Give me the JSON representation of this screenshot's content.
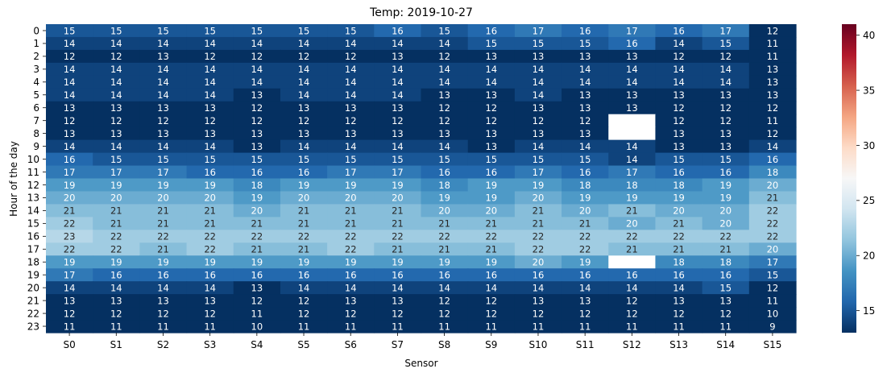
{
  "chart_data": {
    "type": "heatmap",
    "title": "Temp: 2019-10-27",
    "xlabel": "Sensor",
    "ylabel": "Hour of the day",
    "x_categories": [
      "S0",
      "S1",
      "S2",
      "S3",
      "S4",
      "S5",
      "S6",
      "S7",
      "S8",
      "S9",
      "S10",
      "S11",
      "S12",
      "S13",
      "S14",
      "S15"
    ],
    "y_categories": [
      "0",
      "1",
      "2",
      "3",
      "4",
      "5",
      "6",
      "7",
      "8",
      "9",
      "10",
      "11",
      "12",
      "13",
      "14",
      "15",
      "16",
      "17",
      "18",
      "19",
      "20",
      "21",
      "22",
      "23"
    ],
    "values": [
      [
        15,
        15,
        15,
        15,
        15,
        15,
        15,
        16,
        15,
        16,
        17,
        16,
        17,
        16,
        17,
        12
      ],
      [
        14,
        14,
        14,
        14,
        14,
        14,
        14,
        14,
        14,
        15,
        15,
        15,
        16,
        14,
        15,
        11
      ],
      [
        12,
        12,
        13,
        12,
        12,
        12,
        12,
        13,
        12,
        13,
        13,
        13,
        13,
        12,
        12,
        11
      ],
      [
        14,
        14,
        14,
        14,
        14,
        14,
        14,
        14,
        14,
        14,
        14,
        14,
        14,
        14,
        14,
        13
      ],
      [
        14,
        14,
        14,
        14,
        14,
        14,
        14,
        14,
        14,
        14,
        14,
        14,
        14,
        14,
        14,
        13
      ],
      [
        14,
        14,
        14,
        14,
        13,
        14,
        14,
        14,
        13,
        13,
        14,
        13,
        13,
        13,
        13,
        13
      ],
      [
        13,
        13,
        13,
        13,
        12,
        13,
        13,
        13,
        12,
        12,
        13,
        13,
        13,
        12,
        12,
        12
      ],
      [
        12,
        12,
        12,
        12,
        12,
        12,
        12,
        12,
        12,
        12,
        12,
        12,
        null,
        12,
        12,
        11
      ],
      [
        13,
        13,
        13,
        13,
        13,
        13,
        13,
        13,
        13,
        13,
        13,
        13,
        null,
        13,
        13,
        12
      ],
      [
        14,
        14,
        14,
        14,
        13,
        14,
        14,
        14,
        14,
        13,
        14,
        14,
        14,
        13,
        13,
        14
      ],
      [
        16,
        15,
        15,
        15,
        15,
        15,
        15,
        15,
        15,
        15,
        15,
        15,
        14,
        15,
        15,
        16
      ],
      [
        17,
        17,
        17,
        16,
        16,
        16,
        17,
        17,
        16,
        16,
        17,
        16,
        17,
        16,
        16,
        18
      ],
      [
        19,
        19,
        19,
        19,
        18,
        19,
        19,
        19,
        18,
        19,
        19,
        18,
        18,
        18,
        19,
        20
      ],
      [
        20,
        20,
        20,
        20,
        19,
        20,
        20,
        20,
        19,
        19,
        20,
        19,
        19,
        19,
        19,
        21
      ],
      [
        21,
        21,
        21,
        21,
        20,
        21,
        21,
        21,
        20,
        20,
        21,
        20,
        21,
        20,
        20,
        22
      ],
      [
        22,
        21,
        21,
        21,
        21,
        21,
        21,
        21,
        21,
        21,
        21,
        21,
        20,
        21,
        20,
        22
      ],
      [
        23,
        22,
        22,
        22,
        22,
        22,
        22,
        22,
        22,
        22,
        22,
        22,
        22,
        22,
        22,
        22
      ],
      [
        22,
        22,
        21,
        22,
        21,
        21,
        22,
        21,
        21,
        21,
        22,
        22,
        21,
        21,
        21,
        20
      ],
      [
        19,
        19,
        19,
        19,
        19,
        19,
        19,
        19,
        19,
        19,
        20,
        19,
        null,
        18,
        18,
        17
      ],
      [
        17,
        16,
        16,
        16,
        16,
        16,
        16,
        16,
        16,
        16,
        16,
        16,
        16,
        16,
        16,
        15
      ],
      [
        14,
        14,
        14,
        14,
        13,
        14,
        14,
        14,
        14,
        14,
        14,
        14,
        14,
        14,
        15,
        12
      ],
      [
        13,
        13,
        13,
        13,
        12,
        12,
        13,
        13,
        12,
        12,
        13,
        13,
        12,
        13,
        13,
        11
      ],
      [
        12,
        12,
        12,
        12,
        11,
        12,
        12,
        12,
        12,
        12,
        12,
        12,
        12,
        12,
        12,
        10
      ],
      [
        11,
        11,
        11,
        11,
        10,
        11,
        11,
        11,
        11,
        11,
        11,
        11,
        11,
        11,
        11,
        9
      ]
    ],
    "color_scale": {
      "colormap": "RdBu_r",
      "vmin": 13,
      "vmax": 41,
      "ticks": [
        "15",
        "20",
        "25",
        "30",
        "35",
        "40"
      ],
      "tick_values": [
        15,
        20,
        25,
        30,
        35,
        40
      ]
    },
    "missing_color": "#ffffff",
    "grid": false
  }
}
